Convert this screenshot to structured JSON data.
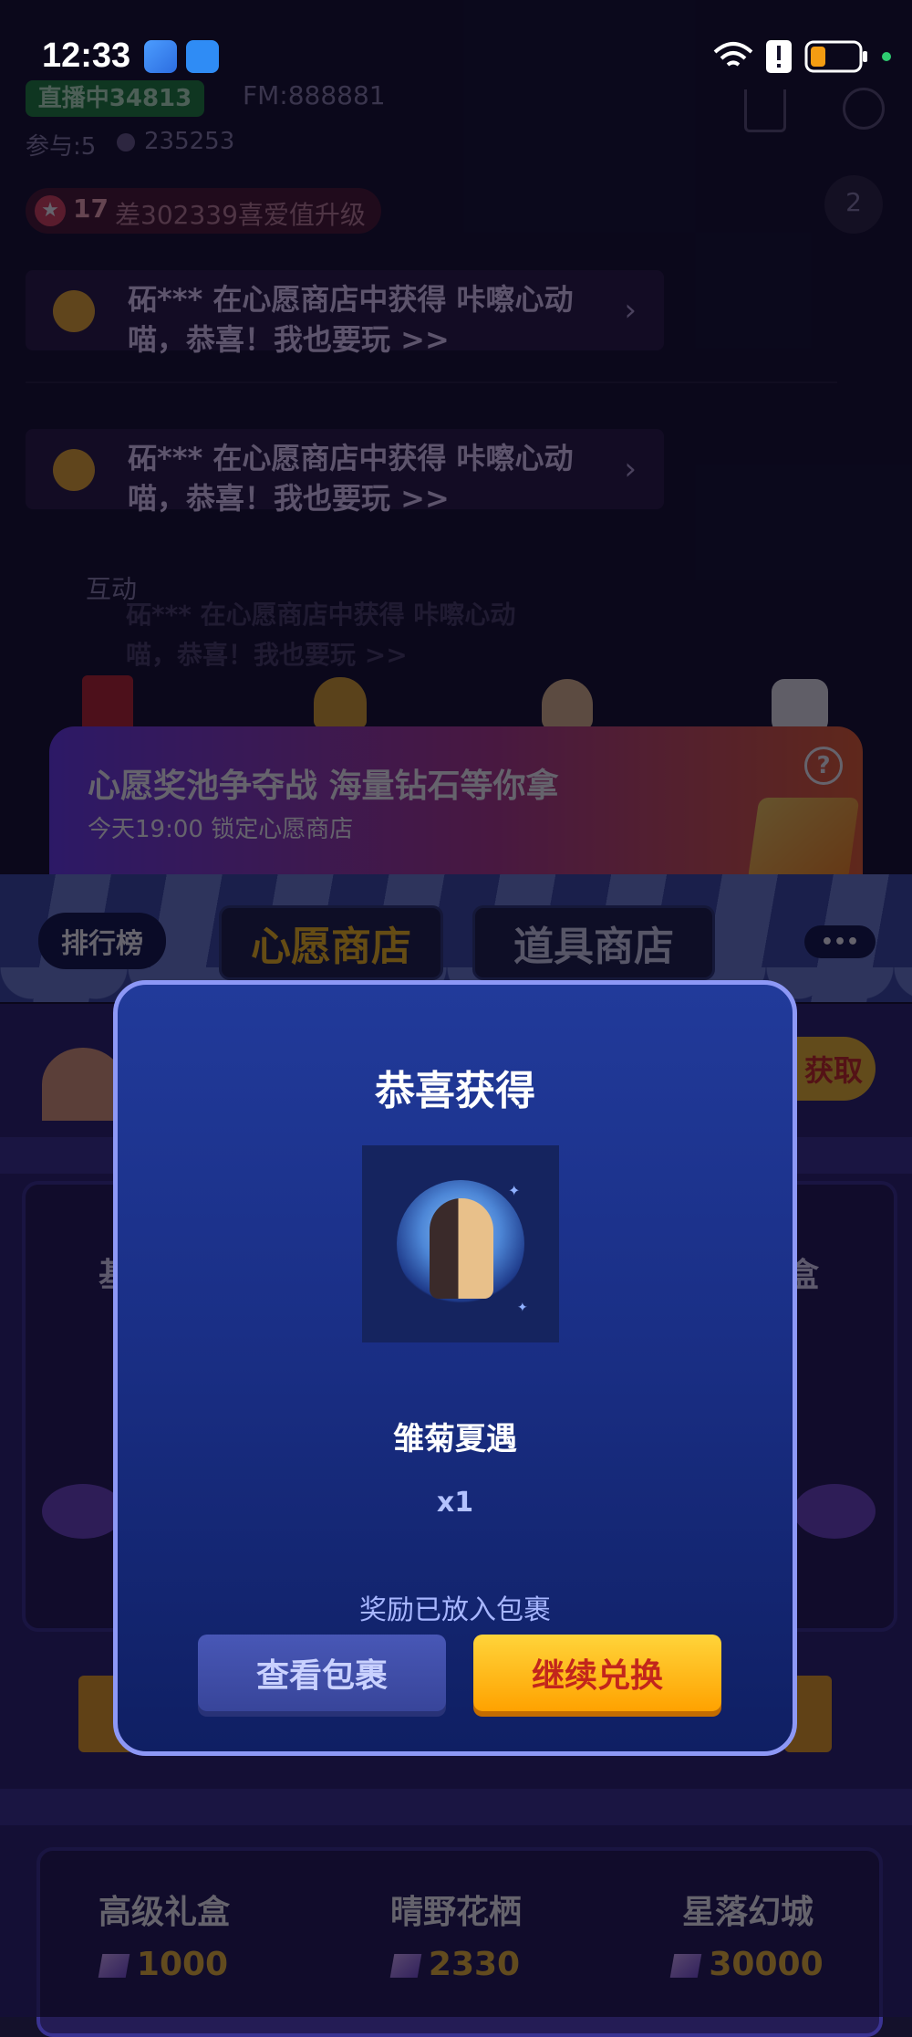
{
  "status_bar": {
    "time": "12:33",
    "battery_color": "#f39c12",
    "dot_color": "#2ecc71"
  },
  "room": {
    "live_badge": "直播中34813",
    "fm": "FM:888881",
    "participants": "参与:5",
    "heat": "235253",
    "level": "17",
    "upgrade_text": "差302339喜爱值升级",
    "rank_number": "2"
  },
  "notices": [
    {
      "text": "砳*** 在心愿商店中获得 咔嚓心动喵，恭喜！我也要玩 >>"
    },
    {
      "text": "砳*** 在心愿商店中获得 咔嚓心动喵，恭喜！我也要玩 >>"
    },
    {
      "text": "砳*** 在心愿商店中获得 咔嚓心动喵，恭喜！我也要玩 >>"
    }
  ],
  "interaction_label": "互动",
  "banner": {
    "title": "心愿奖池争夺战 海量钻石等你拿",
    "subtitle": "今天19:00 锁定心愿商店",
    "help_symbol": "?"
  },
  "shop_tabs": {
    "ranking": "排行榜",
    "wish_shop": "心愿商店",
    "item_shop": "道具商店",
    "more": "•••"
  },
  "obtain_button": "获取",
  "modal": {
    "title": "恭喜获得",
    "prize_name": "雏菊夏遇",
    "quantity": "x1",
    "note": "奖励已放入包裹",
    "view_bag": "查看包裹",
    "continue": "继续兑换"
  },
  "prizes": [
    {
      "name": "高级礼盒",
      "price": "1000"
    },
    {
      "name": "晴野花栖",
      "price": "2330"
    },
    {
      "name": "星落幻城",
      "price": "30000"
    }
  ],
  "partial_labels": {
    "left": "基",
    "right": "盒"
  }
}
